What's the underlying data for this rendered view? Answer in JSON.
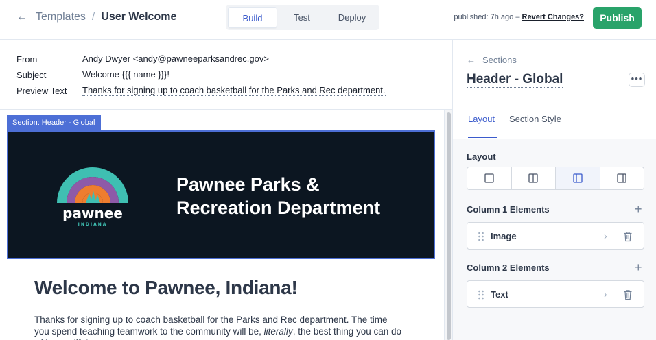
{
  "topbar": {
    "back_label": "←",
    "breadcrumb_parent": "Templates",
    "breadcrumb_separator": "/",
    "breadcrumb_current": "User Welcome",
    "modes": [
      {
        "label": "Build",
        "active": true
      },
      {
        "label": "Test",
        "active": false
      },
      {
        "label": "Deploy",
        "active": false
      }
    ],
    "published_status": "published: 7h ago –",
    "revert_label": "Revert Changes?",
    "publish_label": "Publish"
  },
  "meta": {
    "from_label": "From",
    "from_value": "Andy Dwyer <andy@pawneeparksandrec.gov>",
    "subject_label": "Subject",
    "subject_value": "Welcome {{{ name }}}!",
    "preview_label": "Preview Text",
    "preview_value": "Thanks for signing up to coach basketball for the Parks and Rec department."
  },
  "canvas": {
    "section_tag": "Section: Header - Global",
    "logo_word": "pawnee",
    "logo_sub": "INDIANA",
    "hero_title_line1": "Pawnee Parks &",
    "hero_title_line2": "Recreation Department",
    "welcome_heading": "Welcome to Pawnee, Indiana!",
    "welcome_text_1": "Thanks for signing up to coach basketball for the Parks and Rec department. The time you spend teaching teamwork to the community will be, ",
    "welcome_text_em": "literally",
    "welcome_text_2": ", the best thing you can do with your life!"
  },
  "panel": {
    "sections_link": "Sections",
    "title": "Header - Global",
    "more_label": "•••",
    "tabs": [
      {
        "label": "Layout",
        "active": true
      },
      {
        "label": "Section Style",
        "active": false
      }
    ],
    "layout_label": "Layout",
    "layout_selected": 3,
    "column1_label": "Column 1 Elements",
    "column1_items": [
      "Image"
    ],
    "column2_label": "Column 2 Elements",
    "column2_items": [
      "Text"
    ],
    "add_label": "+"
  },
  "colors": {
    "accent": "#3b5bcc",
    "publish": "#29a36a",
    "header_bg": "#0c1621",
    "selection": "#4d6fd6"
  }
}
